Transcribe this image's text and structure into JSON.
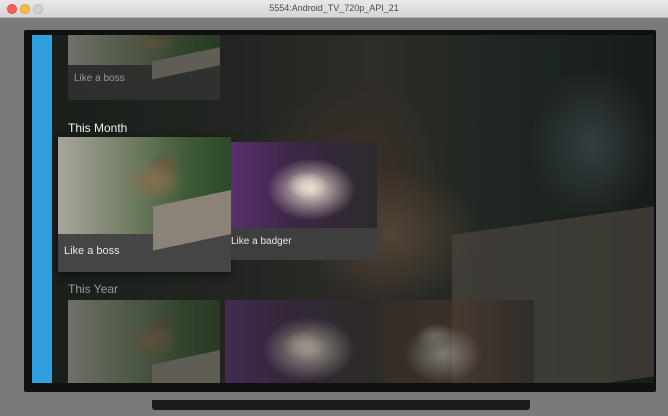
{
  "window": {
    "title": "5554:Android_TV_720p_API_21",
    "controls": [
      "close-dot",
      "minimize-dot",
      "zoom-dot"
    ]
  },
  "colors": {
    "sidebar_accent": "#2f9fe0",
    "card_background": "#3a3a3a"
  },
  "rows": {
    "previous": {
      "cards": [
        {
          "label": "Like a boss",
          "image": "tabby-cat-on-fence"
        }
      ]
    },
    "this_month": {
      "title": "This Month",
      "cards": [
        {
          "label": "Like a boss",
          "image": "tabby-cat-on-fence",
          "focused": true
        },
        {
          "label": "Like a badger",
          "image": "white-fluffy-cat"
        }
      ]
    },
    "this_year": {
      "title": "This Year",
      "cards": [
        {
          "image": "tabby-cat-on-fence"
        },
        {
          "image": "white-fluffy-cat"
        },
        {
          "image": "grey-tabby-cat"
        }
      ]
    }
  }
}
